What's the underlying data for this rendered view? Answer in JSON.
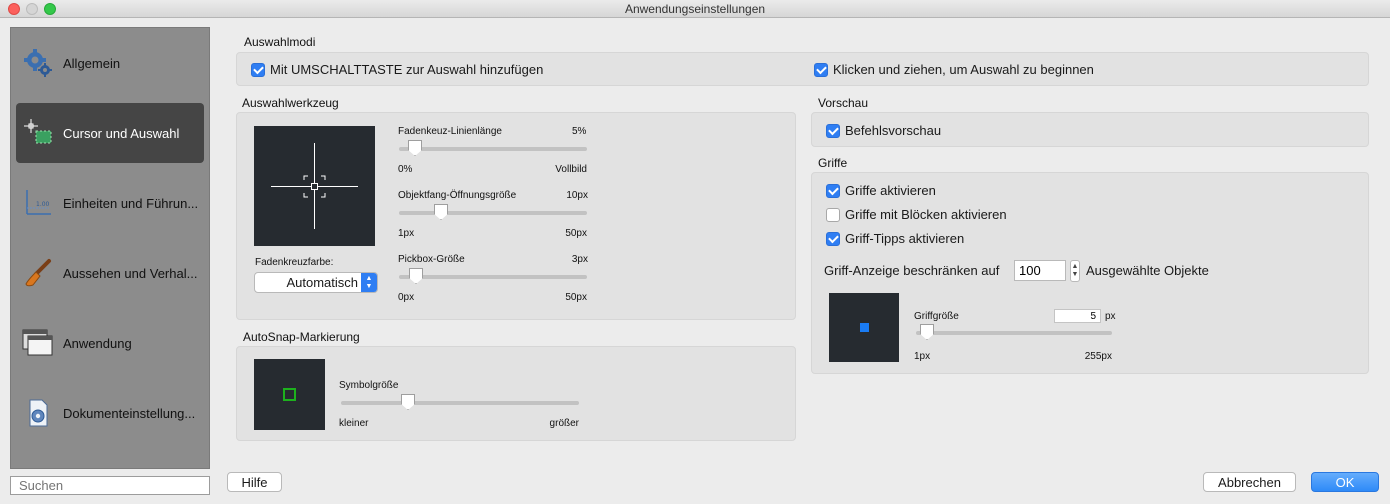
{
  "window": {
    "title": "Anwendungseinstellungen"
  },
  "sidebar": {
    "items": [
      {
        "label": "Allgemein",
        "icon": "gear-icon"
      },
      {
        "label": "Cursor und Auswahl",
        "icon": "cursor-selection-icon",
        "active": true
      },
      {
        "label": "Einheiten und Führun...",
        "icon": "units-guides-icon"
      },
      {
        "label": "Aussehen und Verhal...",
        "icon": "brush-icon"
      },
      {
        "label": "Anwendung",
        "icon": "windows-icon"
      },
      {
        "label": "Dokumenteinstellung...",
        "icon": "document-settings-icon"
      }
    ],
    "search_placeholder": "Suchen"
  },
  "auswahlmodi": {
    "title": "Auswahlmodi",
    "shift_add": {
      "label": "Mit UMSCHALTTASTE zur Auswahl hinzufügen",
      "checked": true
    },
    "click_drag": {
      "label": "Klicken und ziehen, um Auswahl zu beginnen",
      "checked": true
    }
  },
  "auswahlwerkzeug": {
    "title": "Auswahlwerkzeug",
    "crosshair_color_label": "Fadenkreuzfarbe:",
    "crosshair_color_value": "Automatisch",
    "sliders": {
      "crosshair_length": {
        "label": "Fadenkeuz-Linienlänge",
        "value": "5%",
        "min": "0%",
        "max": "Vollbild",
        "fraction": 0.05
      },
      "aperture": {
        "label": "Objektfang-Öffnungsgröße",
        "value": "10px",
        "min": "1px",
        "max": "50px",
        "fraction": 0.2
      },
      "pickbox": {
        "label": "Pickbox-Größe",
        "value": "3px",
        "min": "0px",
        "max": "50px",
        "fraction": 0.06
      }
    }
  },
  "autosnap": {
    "title": "AutoSnap-Markierung",
    "slider": {
      "label": "Symbolgröße",
      "min": "kleiner",
      "max": "größer",
      "fraction": 0.27
    }
  },
  "vorschau": {
    "title": "Vorschau",
    "command_preview": {
      "label": "Befehlsvorschau",
      "checked": true
    }
  },
  "griffe": {
    "title": "Griffe",
    "enable": {
      "label": "Griffe aktivieren",
      "checked": true
    },
    "blocks": {
      "label": "Griffe mit Blöcken aktivieren",
      "checked": false
    },
    "tips": {
      "label": "Griff-Tipps aktivieren",
      "checked": true
    },
    "limit_label": "Griff-Anzeige beschränken auf",
    "limit_value": "100",
    "limit_suffix": "Ausgewählte Objekte",
    "size": {
      "label": "Griffgröße",
      "value": "5",
      "unit": "px",
      "min": "1px",
      "max": "255px",
      "fraction": 0.02
    }
  },
  "buttons": {
    "help": "Hilfe",
    "cancel": "Abbrechen",
    "ok": "OK"
  },
  "colors": {
    "accent": "#2f7ef3",
    "preview_bg": "#262b30",
    "autosnap_marker": "#1db11d",
    "grip_marker": "#1a7cf4"
  }
}
